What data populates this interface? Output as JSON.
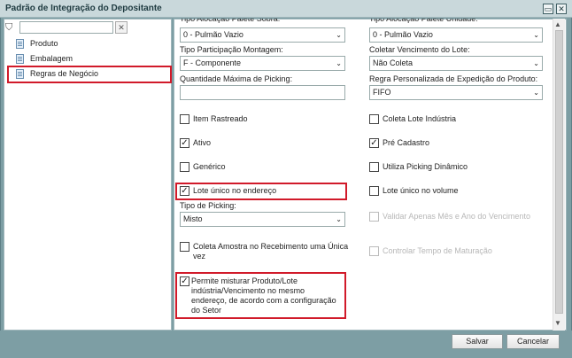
{
  "window": {
    "title": "Padrão de Integração do Depositante",
    "restore_glyph": "▭",
    "close_glyph": "✕"
  },
  "sidebar": {
    "filter_icon": "⛉",
    "filter_value": "",
    "clear_glyph": "✕",
    "items": [
      {
        "label": "Produto"
      },
      {
        "label": "Embalagem"
      },
      {
        "label": "Regras de Negócio"
      }
    ]
  },
  "form": {
    "tipo_alocacao_sobra": {
      "label": "Tipo Alocação Palete Sobra:",
      "value": "0 - Pulmão Vazio"
    },
    "tipo_alocacao_unidade": {
      "label": "Tipo Alocação Palete Unidade:",
      "value": "0 - Pulmão Vazio"
    },
    "tipo_participacao": {
      "label": "Tipo Participação Montagem:",
      "value": "F - Componente"
    },
    "coletar_vencimento": {
      "label": "Coletar Vencimento do Lote:",
      "value": "Não Coleta"
    },
    "quantidade_maxima": {
      "label": "Quantidade Máxima de Picking:",
      "value": ""
    },
    "regra_expedicao": {
      "label": "Regra Personalizada de Expedição do Produto:",
      "value": "FIFO"
    },
    "tipo_picking": {
      "label": "Tipo de Picking:",
      "value": "Misto"
    },
    "checkboxes": {
      "item_rastreado": {
        "label": "Item Rastreado",
        "checked": false
      },
      "coleta_lote_industria": {
        "label": "Coleta Lote Indústria",
        "checked": false
      },
      "ativo": {
        "label": "Ativo",
        "checked": true
      },
      "pre_cadastro": {
        "label": "Pré Cadastro",
        "checked": true
      },
      "generico": {
        "label": "Genérico",
        "checked": false
      },
      "utiliza_picking_dinamico": {
        "label": "Utiliza Picking Dinâmico",
        "checked": false
      },
      "lote_unico_endereco": {
        "label": "Lote único no endereço",
        "checked": true
      },
      "lote_unico_volume": {
        "label": "Lote único no volume",
        "checked": false
      },
      "validar_mes_ano": {
        "label": "Validar Apenas Mês e Ano do Vencimento",
        "checked": false,
        "disabled": true
      },
      "coleta_amostra": {
        "label": "Coleta Amostra no Recebimento uma Única vez",
        "checked": false
      },
      "controlar_maturacao": {
        "label": "Controlar Tempo de Maturação",
        "checked": false,
        "disabled": true
      },
      "permite_misturar": {
        "label": "Permite misturar Produto/Lote indústria/Vencimento no mesmo endereço, de acordo com a configuração do Setor",
        "checked": true
      }
    }
  },
  "buttons": {
    "save": "Salvar",
    "cancel": "Cancelar"
  },
  "glyphs": {
    "dropdown": "⌄",
    "check": "✓",
    "scroll_up": "▲",
    "scroll_down": "▼"
  },
  "colors": {
    "highlight": "#d11a2a",
    "window_bg": "#7d9ea4"
  }
}
